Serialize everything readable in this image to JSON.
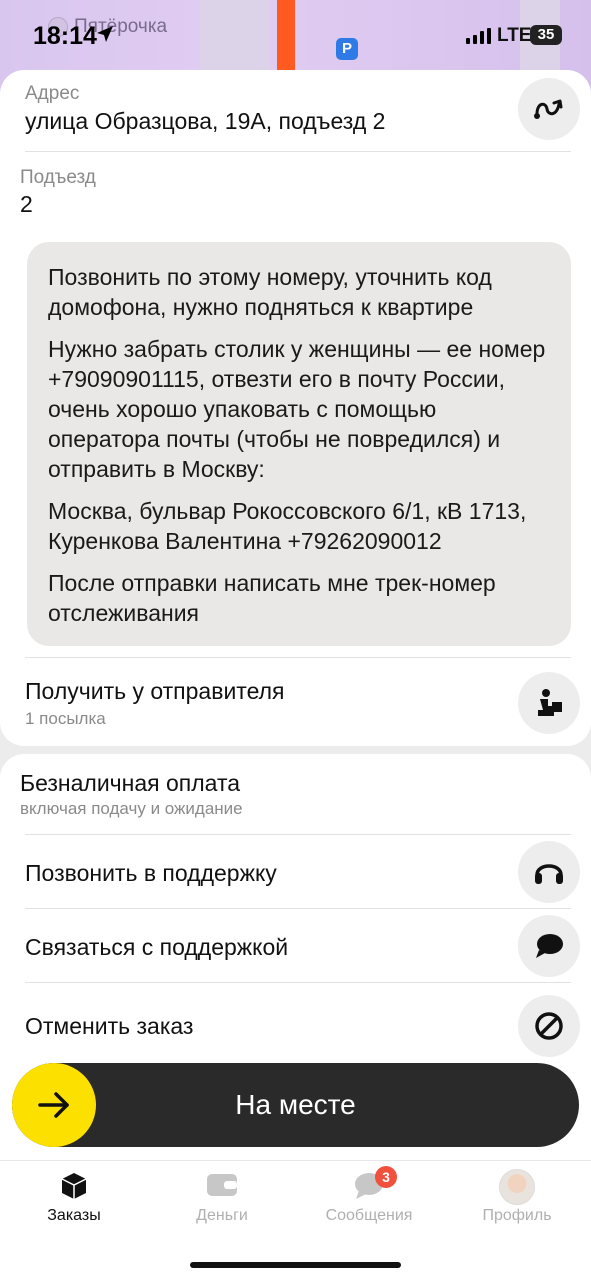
{
  "status_bar": {
    "time": "18:14",
    "network": "LTE",
    "battery": "35"
  },
  "map": {
    "poi_label": "Пятёрочка",
    "parking_label": "P"
  },
  "order": {
    "address_label": "Адрес",
    "address_value": "улица Образцова, 19А, подъезд 2",
    "entrance_label": "Подъезд",
    "entrance_value": "2",
    "comment": [
      "Позвонить по этому номеру, уточнить код домофона, нужно подняться к квартире",
      "Нужно забрать столик у женщины — ее номер +79090901115, отвезти его в почту России, очень хорошо упаковать с помощью оператора почты (чтобы не повредился) и отправить в Москву:",
      "Москва, бульвар Рокоссовского 6/1, кВ 1713, Куренкова Валентина +79262090012",
      "После отправки написать мне трек-номер отслеживания"
    ],
    "pickup_label": "Получить у отправителя",
    "pickup_sub": "1 посылка"
  },
  "payment": {
    "title": "Безналичная оплата",
    "subtitle": "включая подачу и ожидание"
  },
  "actions": {
    "call_support": "Позвонить в поддержку",
    "chat_support": "Связаться с поддержкой",
    "cancel_order": "Отменить заказ"
  },
  "slide_button": {
    "label": "На месте"
  },
  "tabbar": {
    "tabs": [
      {
        "label": "Заказы",
        "active": true
      },
      {
        "label": "Деньги",
        "active": false
      },
      {
        "label": "Сообщения",
        "active": false,
        "badge": "3"
      },
      {
        "label": "Профиль",
        "active": false
      }
    ]
  },
  "colors": {
    "accent_yellow": "#fce000",
    "route_orange": "#ff5a1f",
    "badge_red": "#f0503c"
  }
}
